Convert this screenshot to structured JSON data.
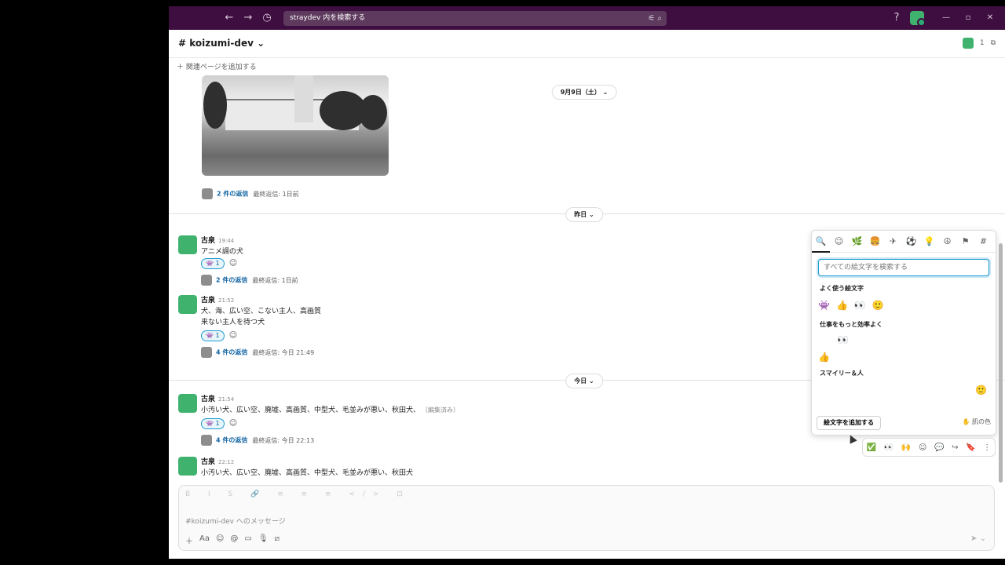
{
  "topbar": {
    "search_text": "straydev 内を検索する"
  },
  "channel": {
    "name": "# koizumi-dev ⌄",
    "member_count": "1",
    "bookmark_add": "＋ 関連ページを追加する"
  },
  "dates": {
    "sep9": "9月9日（土） ⌄",
    "yesterday": "昨日 ⌄",
    "today": "今日 ⌄"
  },
  "photo_thread": {
    "count": "2 件の返信",
    "last": "最終返信: 1日前"
  },
  "messages": [
    {
      "author": "古泉",
      "time": "19:44",
      "lines": [
        "アニメ調の犬"
      ],
      "reaction": "👾 1",
      "thread_count": "2 件の返信",
      "thread_last": "最終返信: 1日前"
    },
    {
      "author": "古泉",
      "time": "21:52",
      "lines": [
        "犬、海、広い空、こない主人、高画質",
        "来ない主人を待つ犬"
      ],
      "reaction": "👾 1",
      "thread_count": "4 件の返信",
      "thread_last": "最終返信: 今日 21:49"
    },
    {
      "author": "古泉",
      "time": "21:54",
      "lines": [
        "小汚い犬、広い空、廃墟、高画質、中型犬、毛並みが悪い、秋田犬、"
      ],
      "edited": "（編集済み）",
      "reaction": "👾 1",
      "thread_count": "4 件の返信",
      "thread_last": "最終返信: 今日 22:13"
    },
    {
      "author": "古泉",
      "time": "22:12",
      "lines": [
        "小汚い犬、広い空、廃墟、高画質、中型犬、毛並みが悪い、秋田犬"
      ]
    }
  ],
  "composer": {
    "placeholder": "#koizumi-dev へのメッセージ",
    "format_icons": "B I S 🔗 ≡ ≡ ≡ </> ⊡",
    "tools": [
      "＋",
      "Aa",
      "☺",
      "@",
      "▭",
      "🎙",
      "⧄"
    ],
    "send": "➤ ⌄"
  },
  "emoji_picker": {
    "tabs": [
      "🔍",
      "☺",
      "🌿",
      "🍔",
      "✈",
      "⚽",
      "💡",
      "☮",
      "⚑",
      "#"
    ],
    "search_placeholder": "すべての絵文字を検索する",
    "frequent_title": "よく使う絵文字",
    "frequent": [
      "👾",
      "👍",
      "👀",
      "🙂"
    ],
    "work_title": "仕事をもっと効率よく",
    "work_row1": [
      "👀"
    ],
    "work_row2": [
      "👍"
    ],
    "smiley_title": "スマイリー＆人",
    "smiley": [
      "🙂"
    ],
    "add_button": "絵文字を追加する",
    "skin_tone": "✋ 肌の色"
  },
  "message_actions": [
    "✅",
    "👀",
    "🙌",
    "☺",
    "💬",
    "↪",
    "🔖",
    "⋮"
  ]
}
